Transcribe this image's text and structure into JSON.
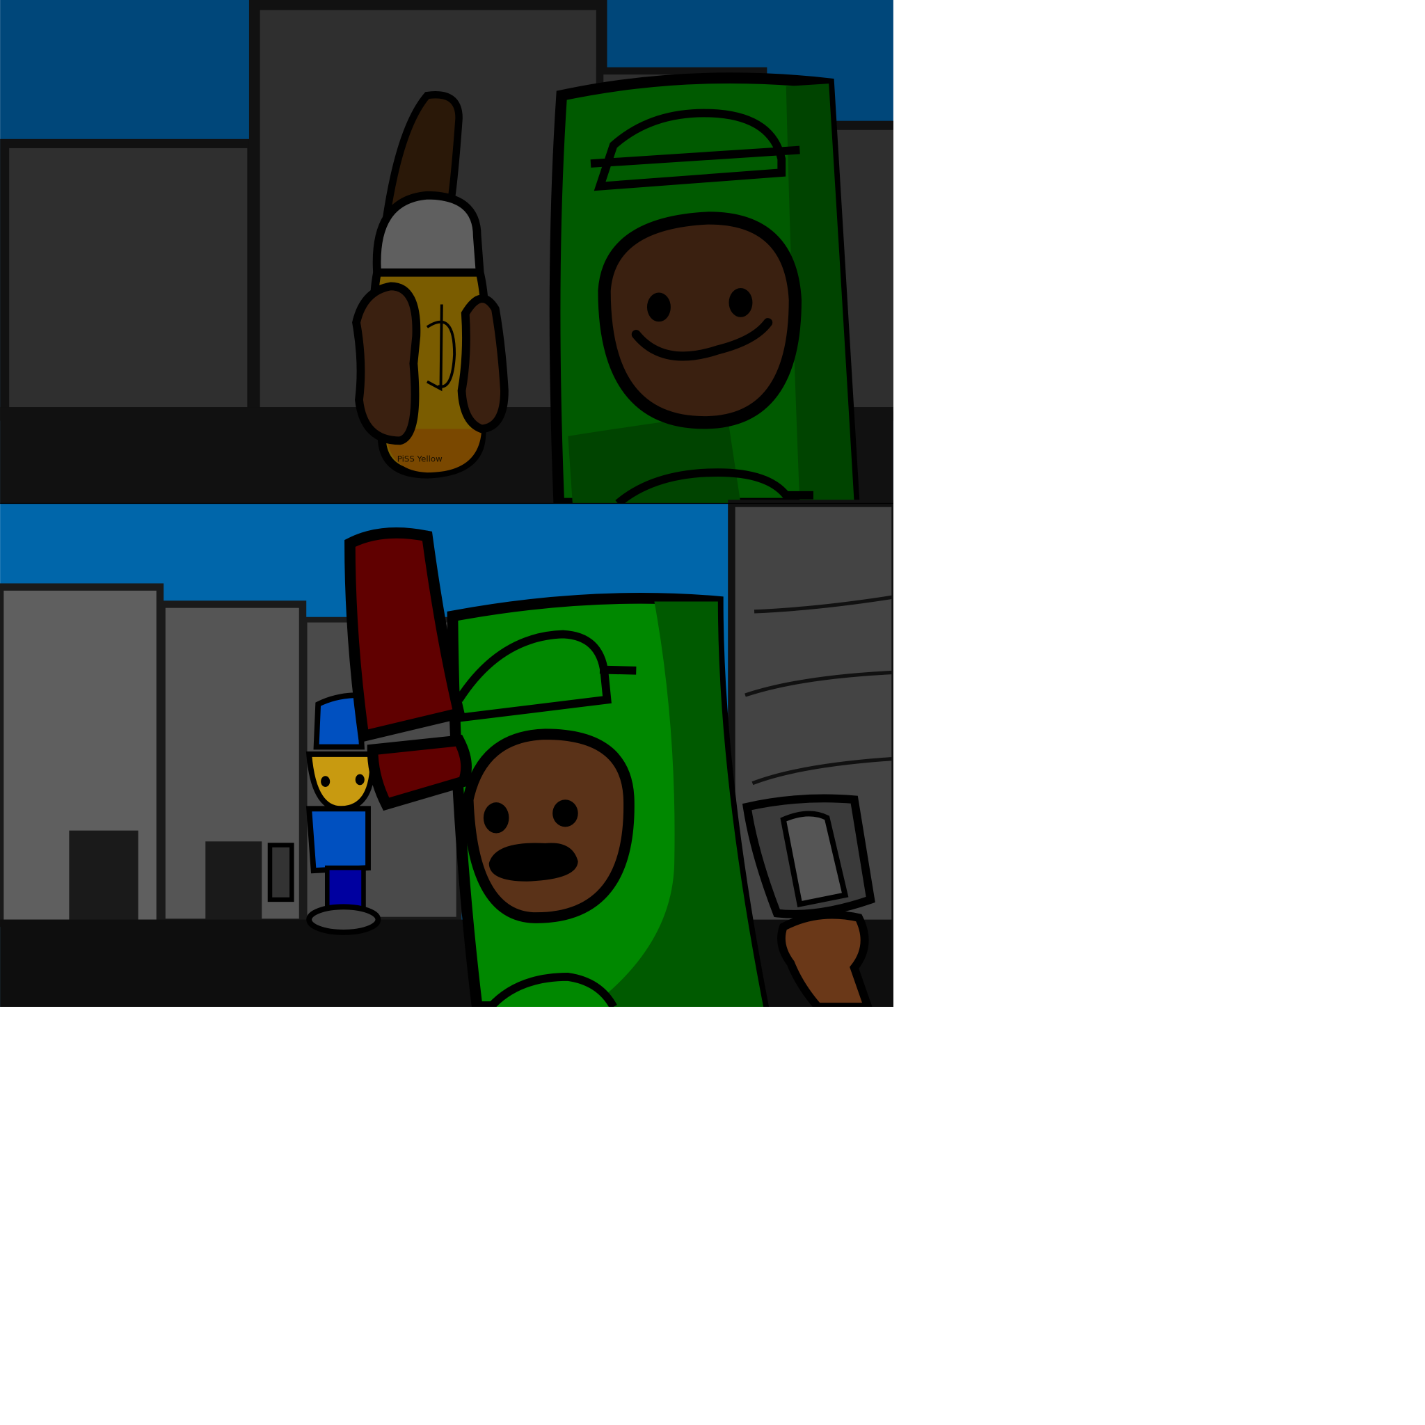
{
  "comic": {
    "panels": [
      {
        "id": "panel-1",
        "bottle_label": "PiSS Yellow"
      },
      {
        "id": "panel-2"
      }
    ],
    "colors": {
      "sky_top": "#00477a",
      "sky_bottom": "#0066aa",
      "building_dark": "#2f2f2f",
      "building_gray": "#5f5f5f",
      "ground": "#111111",
      "green_character": "#005a00",
      "green_character_light": "#008800",
      "face_brown": "#3a2010",
      "bottle_yellow": "#7a5c00",
      "exclamation_red": "#600000",
      "police_blue": "#0050c0"
    }
  }
}
